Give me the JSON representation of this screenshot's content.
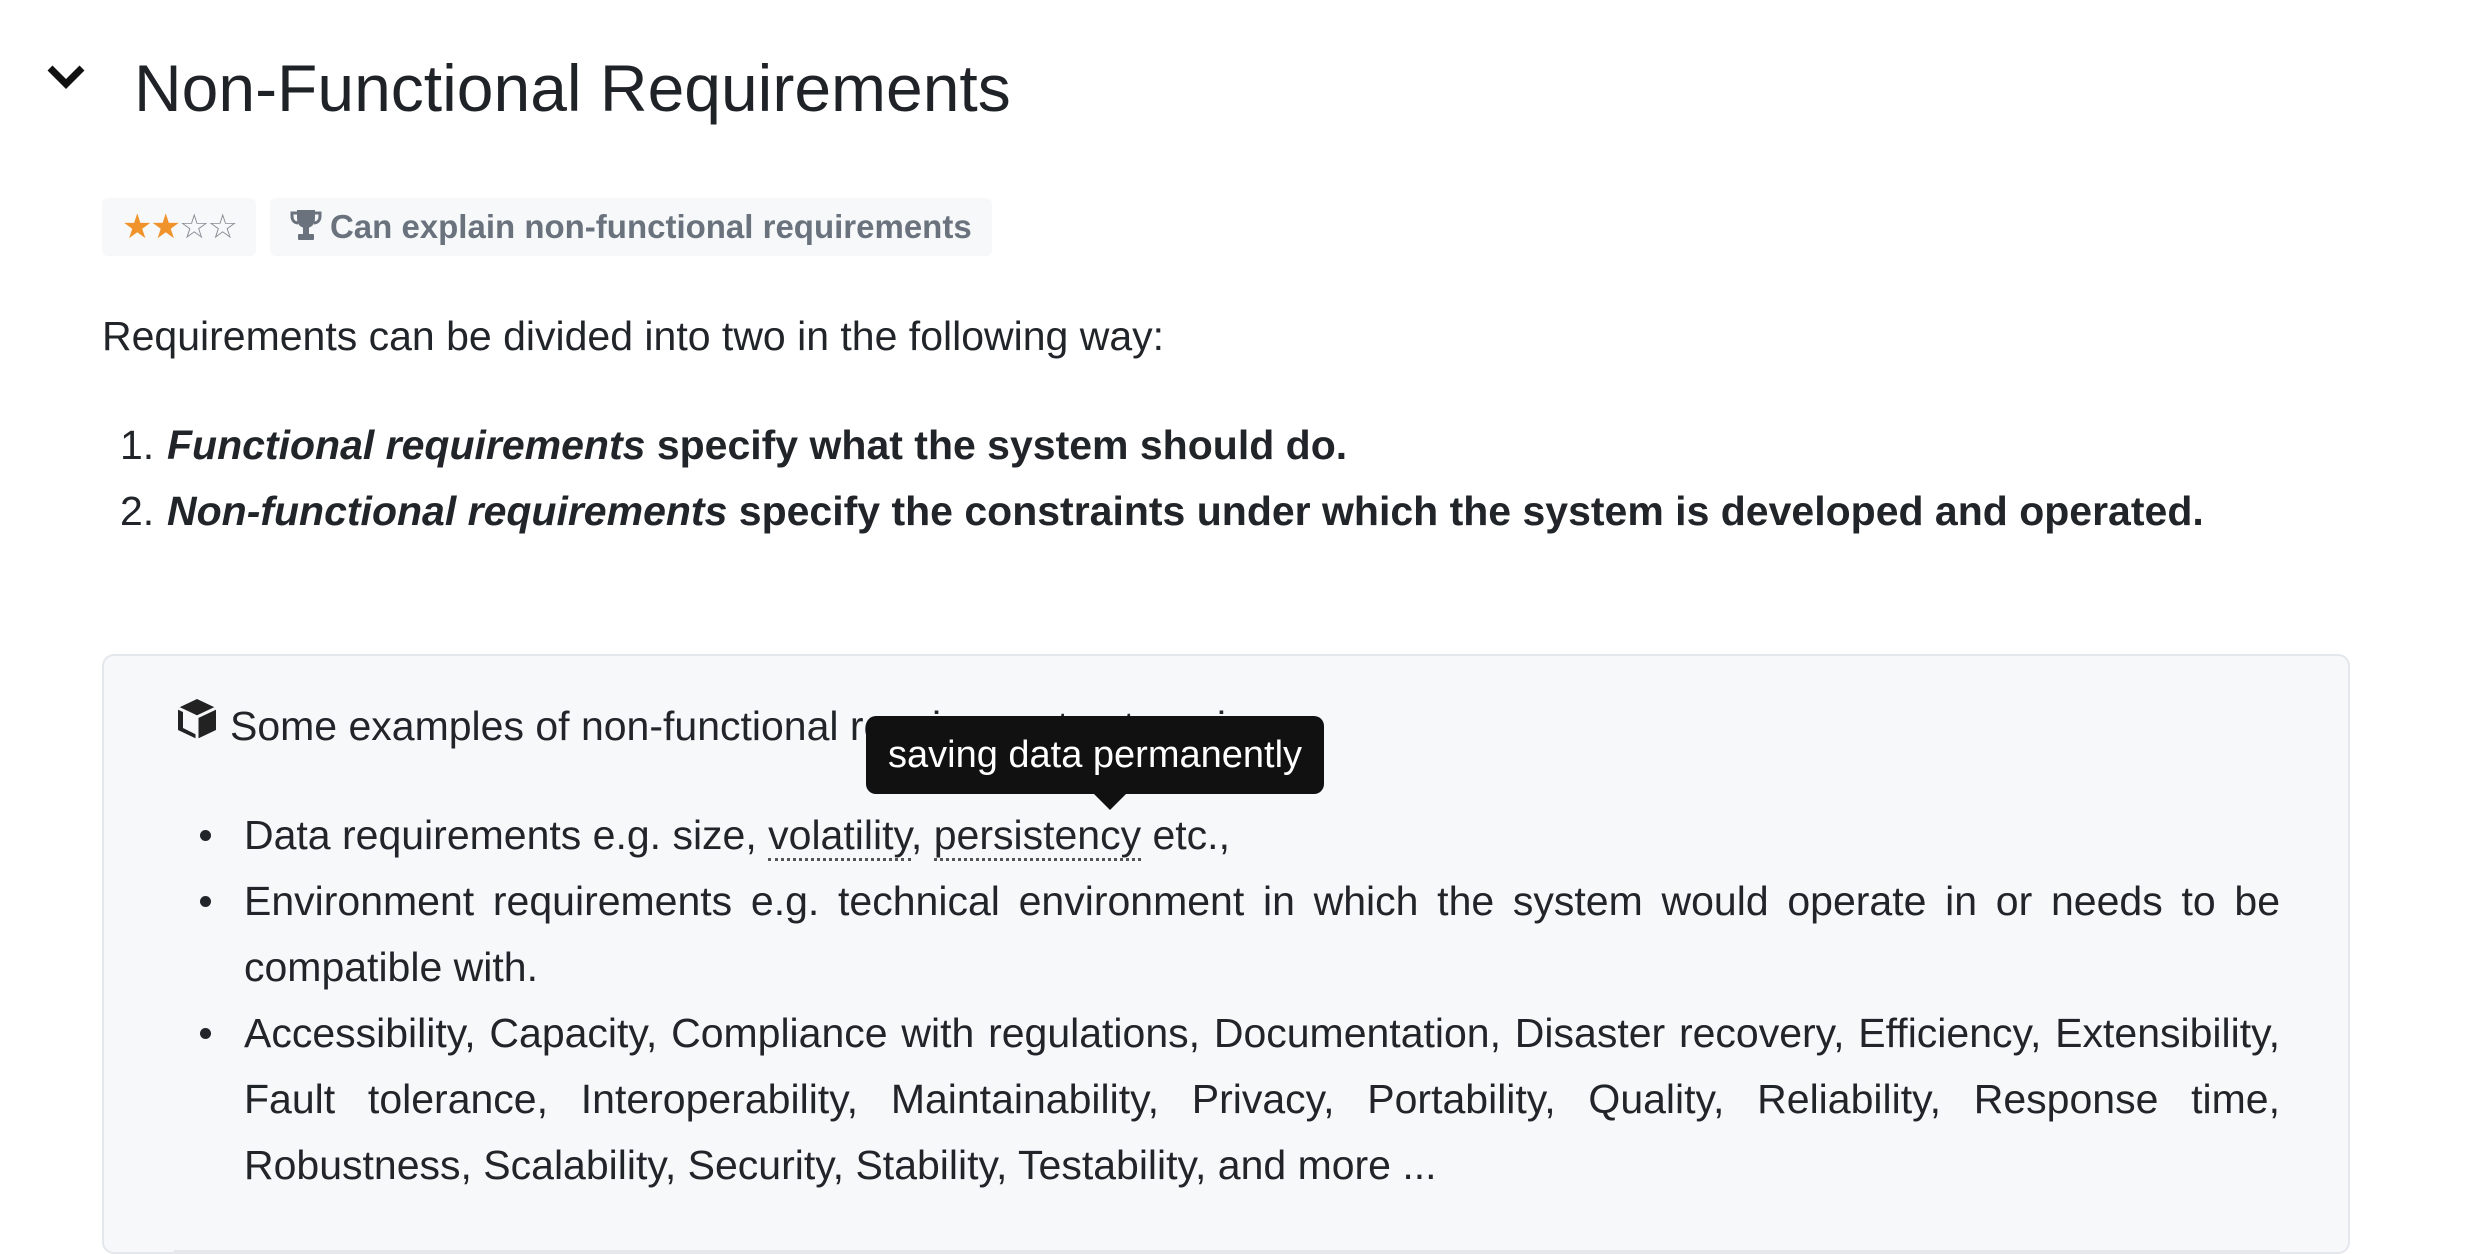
{
  "header": {
    "title": "Non-Functional Requirements",
    "toggle_icon": "chevron-down-icon"
  },
  "badges": {
    "rating": 2,
    "rating_max": 4,
    "achievement_icon": "trophy-icon",
    "achievement_label": "Can explain non-functional requirements"
  },
  "intro": "Requirements can be divided into two in the following way:",
  "requirements": [
    {
      "number": "1.",
      "term": "Functional requirements",
      "text": " specify what the system should do."
    },
    {
      "number": "2.",
      "term": "Non-functional requirements",
      "text": " specify the constraints under which the system is developed and operated."
    }
  ],
  "examples": {
    "icon": "box-icon",
    "heading": "Some examples of non-functional requirement categories:",
    "items": {
      "data": {
        "prefix": "Data requirements e.g. size, ",
        "term1": "volatility",
        "sep": ", ",
        "term2": "persistency",
        "suffix": " etc.,"
      },
      "environment": "Environment requirements e.g. technical environment in which the system would operate in or needs to be compatible with.",
      "others": "Accessibility, Capacity, Compliance with regulations, Documentation, Disaster recovery, Efficiency, Extensibility, Fault tolerance, Interoperability, Maintainability, Privacy, Portability, Quality, Reliability, Response time, Robustness, Scalability, Security, Stability, Testability, and more ..."
    }
  },
  "tooltip": {
    "text": "saving data permanently"
  },
  "colors": {
    "star_filled": "#f0932b",
    "star_empty": "#8a8f96",
    "box_background": "#f6f8fa",
    "tooltip_background": "#111111"
  }
}
